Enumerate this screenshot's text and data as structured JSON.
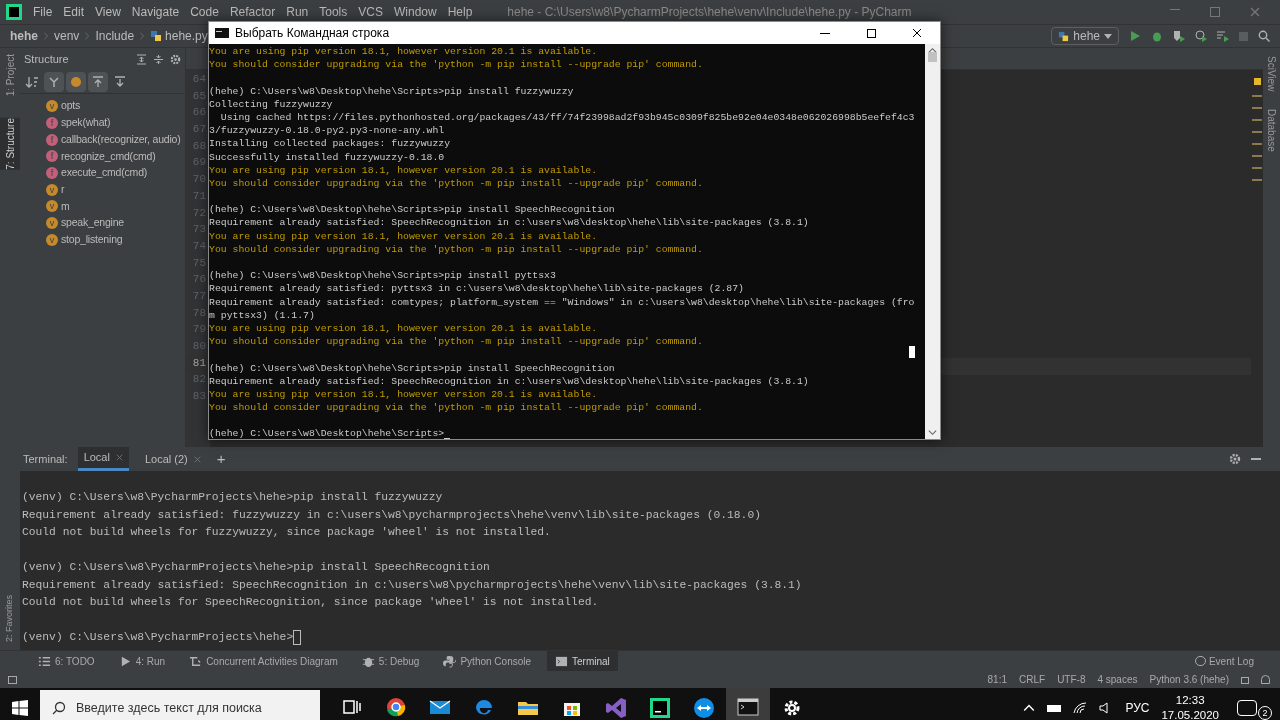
{
  "menu": [
    "File",
    "Edit",
    "View",
    "Navigate",
    "Code",
    "Refactor",
    "Run",
    "Tools",
    "VCS",
    "Window",
    "Help"
  ],
  "title": "hehe - C:\\Users\\w8\\PycharmProjects\\hehe\\venv\\Include\\hehe.py - PyCharm",
  "breadcrumbs": [
    "hehe",
    "venv",
    "Include",
    "hehe.py"
  ],
  "run_config": "hehe",
  "left_strip": [
    {
      "label": "1: Project",
      "selected": false
    },
    {
      "label": "7: Structure",
      "selected": true
    }
  ],
  "structure": {
    "title": "Structure",
    "toolbar": [
      {
        "kind": "sort",
        "on": false
      },
      {
        "kind": "fields",
        "on": true
      },
      {
        "kind": "f",
        "on": true
      },
      {
        "kind": "up",
        "on": true
      },
      {
        "kind": "down",
        "on": false
      }
    ],
    "items": [
      {
        "kind": "variable",
        "badge": "v",
        "label": "opts"
      },
      {
        "kind": "function",
        "badge": "f",
        "label": "spek(what)"
      },
      {
        "kind": "function",
        "badge": "f",
        "label": "callback(recognizer, audio)"
      },
      {
        "kind": "function",
        "badge": "f",
        "label": "recognize_cmd(cmd)"
      },
      {
        "kind": "function",
        "badge": "f",
        "label": "execute_cmd(cmd)"
      },
      {
        "kind": "variable",
        "badge": "v",
        "label": "r"
      },
      {
        "kind": "variable",
        "badge": "v",
        "label": "m"
      },
      {
        "kind": "variable",
        "badge": "v",
        "label": "speak_engine"
      },
      {
        "kind": "variable",
        "badge": "v",
        "label": "stop_listening"
      }
    ]
  },
  "line_numbers": [
    {
      "n": "64",
      "current": false
    },
    {
      "n": "65",
      "current": false
    },
    {
      "n": "66",
      "current": false
    },
    {
      "n": "67",
      "current": false
    },
    {
      "n": "68",
      "current": false
    },
    {
      "n": "69",
      "current": false
    },
    {
      "n": "70",
      "current": false
    },
    {
      "n": "71",
      "current": false
    },
    {
      "n": "72",
      "current": false
    },
    {
      "n": "73",
      "current": false
    },
    {
      "n": "74",
      "current": false
    },
    {
      "n": "75",
      "current": false
    },
    {
      "n": "76",
      "current": false
    },
    {
      "n": "77",
      "current": false
    },
    {
      "n": "78",
      "current": false
    },
    {
      "n": "79",
      "current": false
    },
    {
      "n": "80",
      "current": false
    },
    {
      "n": "81",
      "current": true
    },
    {
      "n": "82",
      "current": false
    },
    {
      "n": "83",
      "current": false
    }
  ],
  "right_strip": [
    "SciView",
    "Database"
  ],
  "cmd": {
    "title": "Выбрать Командная строка",
    "lines": [
      {
        "kind": "warn",
        "text": "You are using pip version 18.1, however version 20.1 is available."
      },
      {
        "kind": "warn",
        "text": "You should consider upgrading via the 'python -m pip install --upgrade pip' command."
      },
      {
        "kind": "blank"
      },
      {
        "kind": "normal",
        "text": "(hehe) C:\\Users\\w8\\Desktop\\hehe\\Scripts>pip install fuzzywuzzy"
      },
      {
        "kind": "normal",
        "text": "Collecting fuzzywuzzy"
      },
      {
        "kind": "normal",
        "text": "  Using cached https://files.pythonhosted.org/packages/43/ff/74f23998ad2f93b945c0309f825be92e04e0348e062026998b5eefef4c3"
      },
      {
        "kind": "normal",
        "text": "3/fuzzywuzzy-0.18.0-py2.py3-none-any.whl"
      },
      {
        "kind": "normal",
        "text": "Installing collected packages: fuzzywuzzy"
      },
      {
        "kind": "normal",
        "text": "Successfully installed fuzzywuzzy-0.18.0"
      },
      {
        "kind": "warn",
        "text": "You are using pip version 18.1, however version 20.1 is available."
      },
      {
        "kind": "warn",
        "text": "You should consider upgrading via the 'python -m pip install --upgrade pip' command."
      },
      {
        "kind": "blank"
      },
      {
        "kind": "normal",
        "text": "(hehe) C:\\Users\\w8\\Desktop\\hehe\\Scripts>pip install SpeechRecognition"
      },
      {
        "kind": "normal",
        "text": "Requirement already satisfied: SpeechRecognition in c:\\users\\w8\\desktop\\hehe\\lib\\site-packages (3.8.1)"
      },
      {
        "kind": "warn",
        "text": "You are using pip version 18.1, however version 20.1 is available."
      },
      {
        "kind": "warn",
        "text": "You should consider upgrading via the 'python -m pip install --upgrade pip' command."
      },
      {
        "kind": "blank"
      },
      {
        "kind": "normal",
        "text": "(hehe) C:\\Users\\w8\\Desktop\\hehe\\Scripts>pip install pyttsx3"
      },
      {
        "kind": "normal",
        "text": "Requirement already satisfied: pyttsx3 in c:\\users\\w8\\desktop\\hehe\\lib\\site-packages (2.87)"
      },
      {
        "kind": "normal",
        "text": "Requirement already satisfied: comtypes; platform_system == \"Windows\" in c:\\users\\w8\\desktop\\hehe\\lib\\site-packages (fro"
      },
      {
        "kind": "normal",
        "text": "m pyttsx3) (1.1.7)"
      },
      {
        "kind": "warn",
        "text": "You are using pip version 18.1, however version 20.1 is available."
      },
      {
        "kind": "warn",
        "text": "You should consider upgrading via the 'python -m pip install --upgrade pip' command."
      },
      {
        "kind": "blank"
      },
      {
        "kind": "normal",
        "text": "(hehe) C:\\Users\\w8\\Desktop\\hehe\\Scripts>pip install SpeechRecognition"
      },
      {
        "kind": "normal",
        "text": "Requirement already satisfied: SpeechRecognition in c:\\users\\w8\\desktop\\hehe\\lib\\site-packages (3.8.1)"
      },
      {
        "kind": "warn",
        "text": "You are using pip version 18.1, however version 20.1 is available."
      },
      {
        "kind": "warn",
        "text": "You should consider upgrading via the 'python -m pip install --upgrade pip' command."
      },
      {
        "kind": "blank"
      }
    ],
    "prompt": "(hehe) C:\\Users\\w8\\Desktop\\hehe\\Scripts>"
  },
  "terminal": {
    "label": "Terminal:",
    "tabs": [
      {
        "label": "Local",
        "selected": true
      },
      {
        "label": "Local (2)",
        "selected": false
      }
    ],
    "add": "+",
    "lines": [
      {
        "kind": "text",
        "text": "(venv) C:\\Users\\w8\\PycharmProjects\\hehe>pip install fuzzywuzzy"
      },
      {
        "kind": "text",
        "text": "Requirement already satisfied: fuzzywuzzy in c:\\users\\w8\\pycharmprojects\\hehe\\venv\\lib\\site-packages (0.18.0)"
      },
      {
        "kind": "text",
        "text": "Could not build wheels for fuzzywuzzy, since package 'wheel' is not installed."
      },
      {
        "kind": "blank"
      },
      {
        "kind": "text",
        "text": "(venv) C:\\Users\\w8\\PycharmProjects\\hehe>pip install SpeechRecognition"
      },
      {
        "kind": "text",
        "text": "Requirement already satisfied: SpeechRecognition in c:\\users\\w8\\pycharmprojects\\hehe\\venv\\lib\\site-packages (3.8.1)"
      },
      {
        "kind": "text",
        "text": "Could not build wheels for SpeechRecognition, since package 'wheel' is not installed."
      },
      {
        "kind": "blank"
      }
    ],
    "prompt": "(venv) C:\\Users\\w8\\PycharmProjects\\hehe>"
  },
  "favorites": "2: Favorites",
  "tool_buttons": [
    {
      "kind": "list",
      "label": "6: TODO",
      "selected": false
    },
    {
      "kind": "run",
      "label": "4: Run",
      "selected": false
    },
    {
      "kind": "diagram",
      "label": "Concurrent Activities Diagram",
      "selected": false
    },
    {
      "kind": "debug",
      "label": "5: Debug",
      "selected": false
    },
    {
      "kind": "python",
      "label": "Python Console",
      "selected": false
    },
    {
      "kind": "terminal",
      "label": "Terminal",
      "selected": true
    }
  ],
  "event_log": "Event Log",
  "status": [
    "81:1",
    "CRLF",
    "UTF-8",
    "4 spaces",
    "Python 3.6 (hehe)"
  ],
  "taskbar": {
    "search_placeholder": "Введите здесь текст для поиска",
    "apps": [
      {
        "kind": "taskview",
        "selected": false
      },
      {
        "kind": "chrome",
        "selected": false
      },
      {
        "kind": "mail",
        "selected": false
      },
      {
        "kind": "edge",
        "selected": false
      },
      {
        "kind": "folder",
        "selected": false
      },
      {
        "kind": "store",
        "selected": false
      },
      {
        "kind": "vs",
        "selected": false
      },
      {
        "kind": "pycharm",
        "selected": false
      },
      {
        "kind": "teamviewer",
        "selected": false
      },
      {
        "kind": "console",
        "selected": true
      },
      {
        "kind": "settings",
        "selected": false
      }
    ],
    "lang": "РУС",
    "time": "12:33",
    "date": "17.05.2020",
    "notifications": "2"
  }
}
